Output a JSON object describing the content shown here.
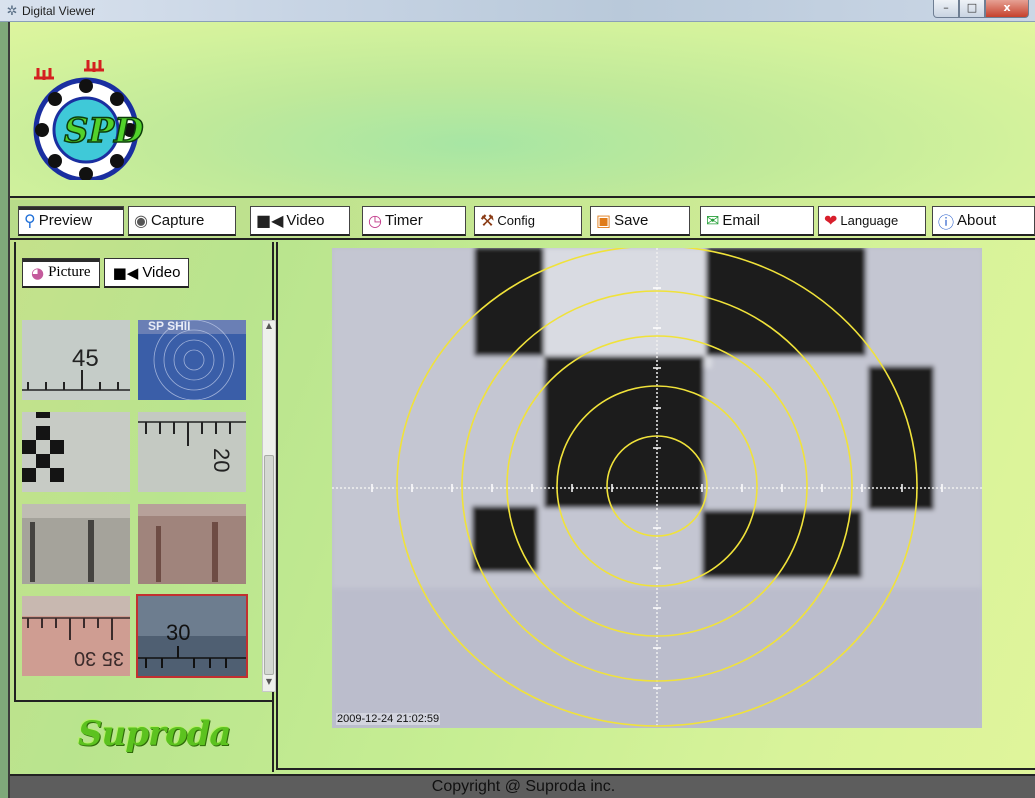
{
  "window": {
    "title": "Digital Viewer",
    "minimize": "–",
    "maximize": "□",
    "close": "x"
  },
  "toolbar": {
    "buttons": [
      {
        "label": "Preview",
        "icon": "search-icon"
      },
      {
        "label": "Capture",
        "icon": "camera-icon"
      },
      {
        "label": "Video",
        "icon": "video-camera-icon"
      },
      {
        "label": "Timer",
        "icon": "clock-icon"
      },
      {
        "label": "Config",
        "icon": "hammer-icon"
      },
      {
        "label": "Save",
        "icon": "floppy-icon"
      },
      {
        "label": "Email",
        "icon": "envelope-icon"
      },
      {
        "label": "Language",
        "icon": "lips-icon"
      },
      {
        "label": "About",
        "icon": "info-icon"
      }
    ]
  },
  "left_panel": {
    "tabs": [
      {
        "label": "Picture",
        "icon": "palette-icon"
      },
      {
        "label": "Video",
        "icon": "video-camera-icon"
      }
    ],
    "thumbnails": [
      {
        "text": "45"
      },
      {
        "text": "SP SHII"
      },
      {
        "text": ""
      },
      {
        "text": "20"
      },
      {
        "text": ""
      },
      {
        "text": ""
      },
      {
        "text": "35 30"
      },
      {
        "text": "30"
      }
    ]
  },
  "brand": {
    "name": "Suproda"
  },
  "logo": {
    "text": "SPD"
  },
  "viewer": {
    "timestamp": "2009-12-24 21:02:59"
  },
  "footer": {
    "copyright": "Copyright @ Suproda inc."
  },
  "colors": {
    "crosshair": "#f0e23a",
    "accent_green": "#5cc21f"
  }
}
